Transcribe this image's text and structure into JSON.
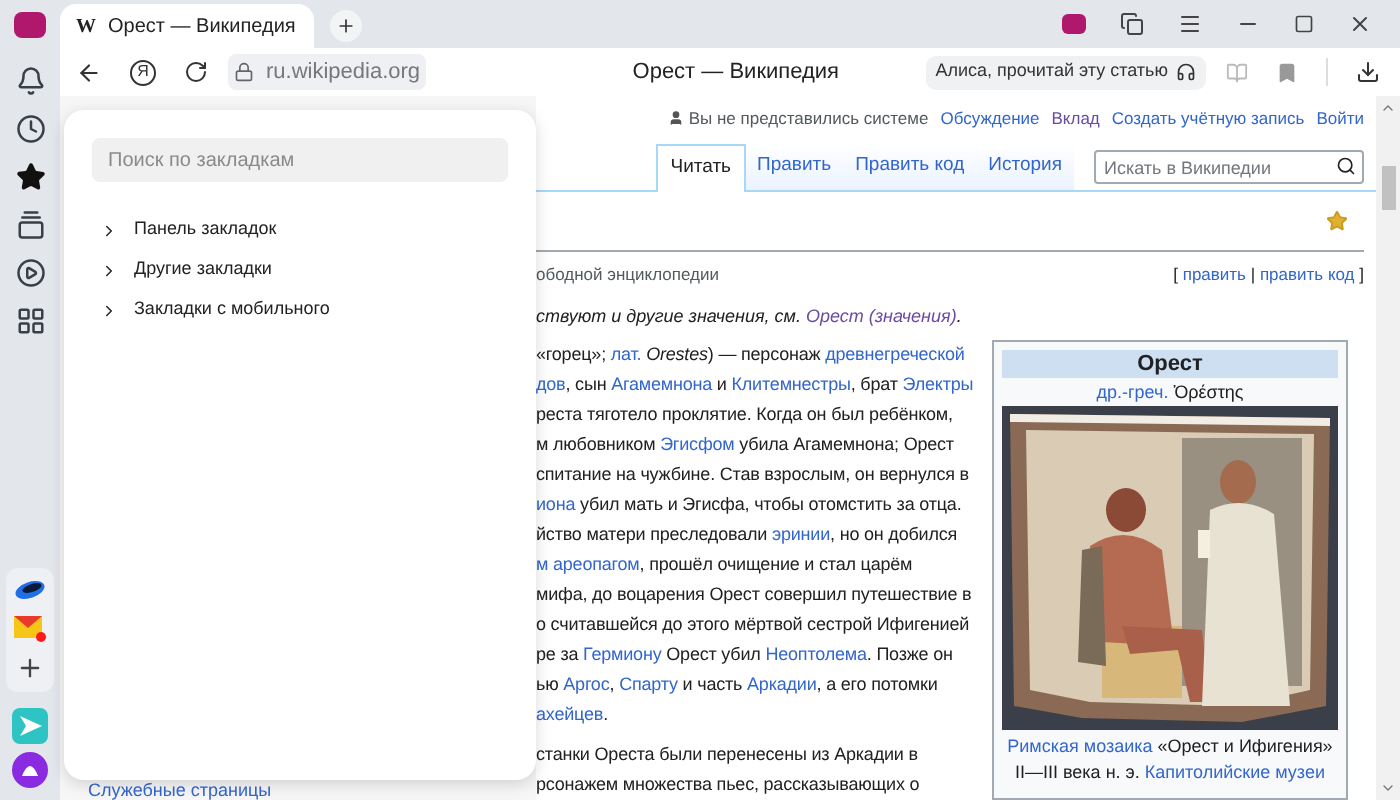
{
  "browser": {
    "tab": {
      "favicon": "W",
      "title": "Орест — Википедия"
    },
    "search_logo": "Я",
    "address": "ru.wikipedia.org",
    "page_title": "Орест — Википедия",
    "alice_prompt": "Алиса, прочитай эту статью"
  },
  "bookmarks_panel": {
    "search": {
      "placeholder": "Поиск по закладкам"
    },
    "folders": [
      {
        "label": "Панель закладок",
        "expanded": false
      },
      {
        "label": "Другие закладки",
        "expanded": false
      },
      {
        "label": "Закладки с мобильного",
        "expanded": false
      }
    ]
  },
  "wiki": {
    "user_status": "Вы не представились системе",
    "user_links": [
      {
        "text": "Обсуждение",
        "kind": "link"
      },
      {
        "text": "Вклад",
        "kind": "visited"
      },
      {
        "text": "Создать учётную запись",
        "kind": "link"
      },
      {
        "text": "Войти",
        "kind": "link"
      }
    ],
    "tabs": [
      {
        "label": "Читать",
        "selected": true
      },
      {
        "label": "Править",
        "selected": false
      },
      {
        "label": "Править код",
        "selected": false
      },
      {
        "label": "История",
        "selected": false
      }
    ],
    "search": {
      "placeholder": "Искать в Википедии"
    },
    "subtitle": "ободной энциклопедии",
    "edit_links": [
      {
        "text": "[ ",
        "kind": "text"
      },
      {
        "text": "править",
        "kind": "link"
      },
      {
        "text": " | ",
        "kind": "text"
      },
      {
        "text": "править код",
        "kind": "link"
      },
      {
        "text": " ]",
        "kind": "text"
      }
    ],
    "hatnote": [
      {
        "text": "ствуют и другие значения, см. ",
        "kind": "text",
        "italic": true
      },
      {
        "text": "Орест (значения)",
        "kind": "visited",
        "italic": true
      },
      {
        "text": ".",
        "kind": "text",
        "italic": true
      }
    ],
    "paragraphs": [
      {
        "lines": [
          [
            {
              "text": "«горец»; ",
              "kind": "text"
            },
            {
              "text": "лат.",
              "kind": "link"
            },
            {
              "text": " Orestes",
              "kind": "text",
              "italic": true
            },
            {
              "text": ") — персонаж ",
              "kind": "text"
            },
            {
              "text": "древнегреческой",
              "kind": "link"
            }
          ],
          [
            {
              "text": "дов",
              "kind": "link"
            },
            {
              "text": ", сын ",
              "kind": "text"
            },
            {
              "text": "Агамемнона",
              "kind": "link"
            },
            {
              "text": " и ",
              "kind": "text"
            },
            {
              "text": "Клитемнестры",
              "kind": "link"
            },
            {
              "text": ", брат ",
              "kind": "text"
            },
            {
              "text": "Электры",
              "kind": "link"
            }
          ],
          [
            {
              "text": "реста тяготело проклятие. Когда он был ребёнком,",
              "kind": "text"
            }
          ],
          [
            {
              "text": "м любовником ",
              "kind": "text"
            },
            {
              "text": "Эгисфом",
              "kind": "link"
            },
            {
              "text": " убила Агамемнона; Орест",
              "kind": "text"
            }
          ],
          [
            {
              "text": "спитание на чужбине. Став взрослым, он вернулся в",
              "kind": "text"
            }
          ],
          [
            {
              "text": "иона",
              "kind": "link"
            },
            {
              "text": " убил мать и Эгисфа, чтобы отомстить за отца.",
              "kind": "text"
            }
          ],
          [
            {
              "text": "йство матери преследовали ",
              "kind": "text"
            },
            {
              "text": "эринии",
              "kind": "link"
            },
            {
              "text": ", но он добился",
              "kind": "text"
            }
          ],
          [
            {
              "text": "м ареопагом",
              "kind": "link"
            },
            {
              "text": ", прошёл очищение и стал царём",
              "kind": "text"
            }
          ],
          [
            {
              "text": " мифа, до воцарения Орест совершил путешествие в",
              "kind": "text"
            }
          ],
          [
            {
              "text": "о считавшейся до этого мёртвой сестрой Ифигенией",
              "kind": "text"
            }
          ],
          [
            {
              "text": "ре за ",
              "kind": "text"
            },
            {
              "text": "Гермиону",
              "kind": "link"
            },
            {
              "text": " Орест убил ",
              "kind": "text"
            },
            {
              "text": "Неоптолема",
              "kind": "link"
            },
            {
              "text": ". Позже он",
              "kind": "text"
            }
          ],
          [
            {
              "text": "ью ",
              "kind": "text"
            },
            {
              "text": "Аргос",
              "kind": "link"
            },
            {
              "text": ", ",
              "kind": "text"
            },
            {
              "text": "Спарту",
              "kind": "link"
            },
            {
              "text": " и часть ",
              "kind": "text"
            },
            {
              "text": "Аркадии",
              "kind": "link"
            },
            {
              "text": ", а его потомки",
              "kind": "text"
            }
          ],
          [
            {
              "text": "ахейцев",
              "kind": "link"
            },
            {
              "text": ".",
              "kind": "text"
            }
          ]
        ]
      },
      {
        "lines": [
          [
            {
              "text": "станки Ореста были перенесены из Аркадии в",
              "kind": "text"
            }
          ],
          [
            {
              "text": "рсонажем множества пьес, рассказывающих о",
              "kind": "text"
            }
          ]
        ]
      }
    ],
    "infobox": {
      "title": "Орест",
      "subtitle": [
        {
          "text": "др.-греч.",
          "kind": "link"
        },
        {
          "text": " Ὀρέστης",
          "kind": "text"
        }
      ],
      "caption": [
        [
          {
            "text": "Римская мозаика",
            "kind": "link"
          },
          {
            "text": " «Орест и Ифигения»",
            "kind": "text"
          }
        ],
        [
          {
            "text": "II—III века н. э. ",
            "kind": "text"
          },
          {
            "text": "Капитолийские музеи",
            "kind": "link"
          }
        ]
      ]
    },
    "sidebar_link": "Служебные страницы"
  }
}
